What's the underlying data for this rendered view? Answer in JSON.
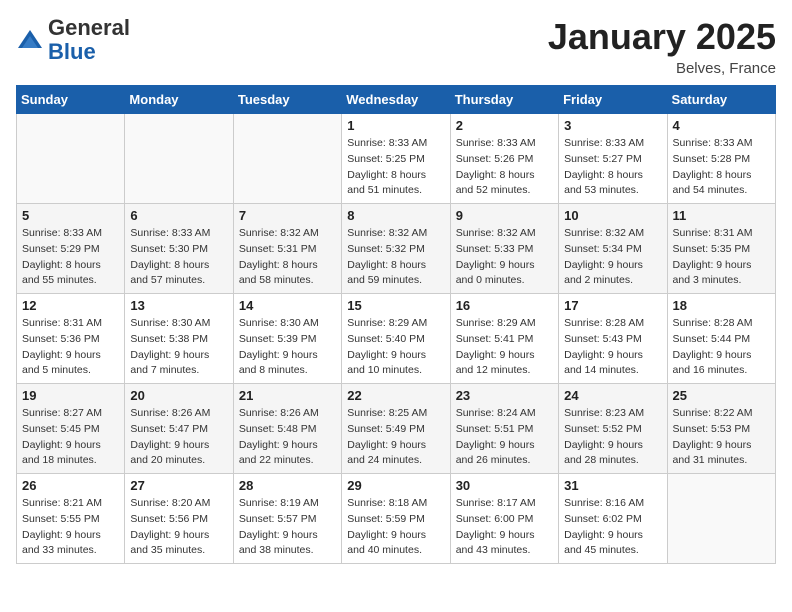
{
  "logo": {
    "general": "General",
    "blue": "Blue"
  },
  "header": {
    "title": "January 2025",
    "location": "Belves, France"
  },
  "days_of_week": [
    "Sunday",
    "Monday",
    "Tuesday",
    "Wednesday",
    "Thursday",
    "Friday",
    "Saturday"
  ],
  "weeks": [
    [
      {
        "day": "",
        "sunrise": "",
        "sunset": "",
        "daylight": ""
      },
      {
        "day": "",
        "sunrise": "",
        "sunset": "",
        "daylight": ""
      },
      {
        "day": "",
        "sunrise": "",
        "sunset": "",
        "daylight": ""
      },
      {
        "day": "1",
        "sunrise": "Sunrise: 8:33 AM",
        "sunset": "Sunset: 5:25 PM",
        "daylight": "Daylight: 8 hours and 51 minutes."
      },
      {
        "day": "2",
        "sunrise": "Sunrise: 8:33 AM",
        "sunset": "Sunset: 5:26 PM",
        "daylight": "Daylight: 8 hours and 52 minutes."
      },
      {
        "day": "3",
        "sunrise": "Sunrise: 8:33 AM",
        "sunset": "Sunset: 5:27 PM",
        "daylight": "Daylight: 8 hours and 53 minutes."
      },
      {
        "day": "4",
        "sunrise": "Sunrise: 8:33 AM",
        "sunset": "Sunset: 5:28 PM",
        "daylight": "Daylight: 8 hours and 54 minutes."
      }
    ],
    [
      {
        "day": "5",
        "sunrise": "Sunrise: 8:33 AM",
        "sunset": "Sunset: 5:29 PM",
        "daylight": "Daylight: 8 hours and 55 minutes."
      },
      {
        "day": "6",
        "sunrise": "Sunrise: 8:33 AM",
        "sunset": "Sunset: 5:30 PM",
        "daylight": "Daylight: 8 hours and 57 minutes."
      },
      {
        "day": "7",
        "sunrise": "Sunrise: 8:32 AM",
        "sunset": "Sunset: 5:31 PM",
        "daylight": "Daylight: 8 hours and 58 minutes."
      },
      {
        "day": "8",
        "sunrise": "Sunrise: 8:32 AM",
        "sunset": "Sunset: 5:32 PM",
        "daylight": "Daylight: 8 hours and 59 minutes."
      },
      {
        "day": "9",
        "sunrise": "Sunrise: 8:32 AM",
        "sunset": "Sunset: 5:33 PM",
        "daylight": "Daylight: 9 hours and 0 minutes."
      },
      {
        "day": "10",
        "sunrise": "Sunrise: 8:32 AM",
        "sunset": "Sunset: 5:34 PM",
        "daylight": "Daylight: 9 hours and 2 minutes."
      },
      {
        "day": "11",
        "sunrise": "Sunrise: 8:31 AM",
        "sunset": "Sunset: 5:35 PM",
        "daylight": "Daylight: 9 hours and 3 minutes."
      }
    ],
    [
      {
        "day": "12",
        "sunrise": "Sunrise: 8:31 AM",
        "sunset": "Sunset: 5:36 PM",
        "daylight": "Daylight: 9 hours and 5 minutes."
      },
      {
        "day": "13",
        "sunrise": "Sunrise: 8:30 AM",
        "sunset": "Sunset: 5:38 PM",
        "daylight": "Daylight: 9 hours and 7 minutes."
      },
      {
        "day": "14",
        "sunrise": "Sunrise: 8:30 AM",
        "sunset": "Sunset: 5:39 PM",
        "daylight": "Daylight: 9 hours and 8 minutes."
      },
      {
        "day": "15",
        "sunrise": "Sunrise: 8:29 AM",
        "sunset": "Sunset: 5:40 PM",
        "daylight": "Daylight: 9 hours and 10 minutes."
      },
      {
        "day": "16",
        "sunrise": "Sunrise: 8:29 AM",
        "sunset": "Sunset: 5:41 PM",
        "daylight": "Daylight: 9 hours and 12 minutes."
      },
      {
        "day": "17",
        "sunrise": "Sunrise: 8:28 AM",
        "sunset": "Sunset: 5:43 PM",
        "daylight": "Daylight: 9 hours and 14 minutes."
      },
      {
        "day": "18",
        "sunrise": "Sunrise: 8:28 AM",
        "sunset": "Sunset: 5:44 PM",
        "daylight": "Daylight: 9 hours and 16 minutes."
      }
    ],
    [
      {
        "day": "19",
        "sunrise": "Sunrise: 8:27 AM",
        "sunset": "Sunset: 5:45 PM",
        "daylight": "Daylight: 9 hours and 18 minutes."
      },
      {
        "day": "20",
        "sunrise": "Sunrise: 8:26 AM",
        "sunset": "Sunset: 5:47 PM",
        "daylight": "Daylight: 9 hours and 20 minutes."
      },
      {
        "day": "21",
        "sunrise": "Sunrise: 8:26 AM",
        "sunset": "Sunset: 5:48 PM",
        "daylight": "Daylight: 9 hours and 22 minutes."
      },
      {
        "day": "22",
        "sunrise": "Sunrise: 8:25 AM",
        "sunset": "Sunset: 5:49 PM",
        "daylight": "Daylight: 9 hours and 24 minutes."
      },
      {
        "day": "23",
        "sunrise": "Sunrise: 8:24 AM",
        "sunset": "Sunset: 5:51 PM",
        "daylight": "Daylight: 9 hours and 26 minutes."
      },
      {
        "day": "24",
        "sunrise": "Sunrise: 8:23 AM",
        "sunset": "Sunset: 5:52 PM",
        "daylight": "Daylight: 9 hours and 28 minutes."
      },
      {
        "day": "25",
        "sunrise": "Sunrise: 8:22 AM",
        "sunset": "Sunset: 5:53 PM",
        "daylight": "Daylight: 9 hours and 31 minutes."
      }
    ],
    [
      {
        "day": "26",
        "sunrise": "Sunrise: 8:21 AM",
        "sunset": "Sunset: 5:55 PM",
        "daylight": "Daylight: 9 hours and 33 minutes."
      },
      {
        "day": "27",
        "sunrise": "Sunrise: 8:20 AM",
        "sunset": "Sunset: 5:56 PM",
        "daylight": "Daylight: 9 hours and 35 minutes."
      },
      {
        "day": "28",
        "sunrise": "Sunrise: 8:19 AM",
        "sunset": "Sunset: 5:57 PM",
        "daylight": "Daylight: 9 hours and 38 minutes."
      },
      {
        "day": "29",
        "sunrise": "Sunrise: 8:18 AM",
        "sunset": "Sunset: 5:59 PM",
        "daylight": "Daylight: 9 hours and 40 minutes."
      },
      {
        "day": "30",
        "sunrise": "Sunrise: 8:17 AM",
        "sunset": "Sunset: 6:00 PM",
        "daylight": "Daylight: 9 hours and 43 minutes."
      },
      {
        "day": "31",
        "sunrise": "Sunrise: 8:16 AM",
        "sunset": "Sunset: 6:02 PM",
        "daylight": "Daylight: 9 hours and 45 minutes."
      },
      {
        "day": "",
        "sunrise": "",
        "sunset": "",
        "daylight": ""
      }
    ]
  ]
}
